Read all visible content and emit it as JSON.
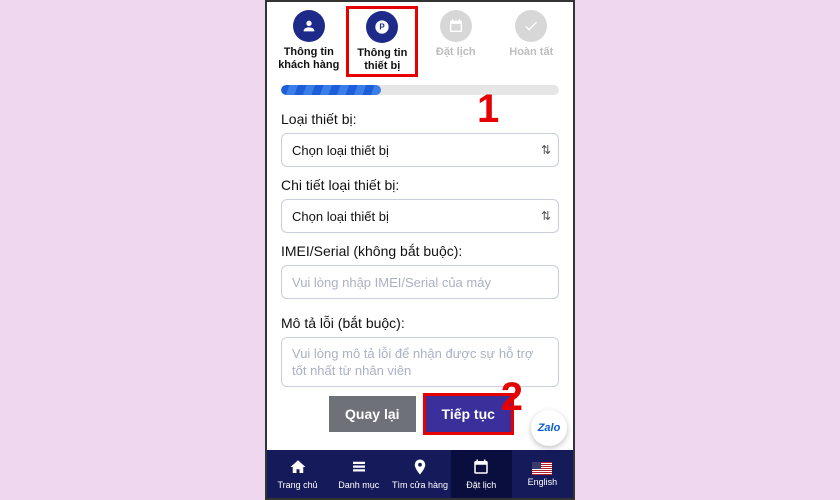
{
  "stepper": {
    "items": [
      {
        "label": "Thông tin khách hàng",
        "icon": "user-icon",
        "active": true
      },
      {
        "label": "Thông tin thiết bị",
        "icon": "p-icon",
        "active": true,
        "highlighted": true
      },
      {
        "label": "Đặt lịch",
        "icon": "calendar-icon",
        "active": false
      },
      {
        "label": "Hoàn tất",
        "icon": "check-icon",
        "active": false
      }
    ],
    "progress_percent": 36
  },
  "annotations": {
    "one": "1",
    "two": "2"
  },
  "form": {
    "device_type_label": "Loại thiết bị:",
    "device_type_value": "Chọn loại thiết bị",
    "device_detail_label": "Chi tiết loại thiết bị:",
    "device_detail_value": "Chọn loại thiết bị",
    "imei_label": "IMEI/Serial (không bắt buộc):",
    "imei_placeholder": "Vui lòng nhập IMEI/Serial của máy",
    "desc_label": "Mô tả lỗi (bắt buộc):",
    "desc_placeholder": "Vui lòng mô tả lỗi để nhận được sự hỗ trợ tốt nhất từ nhân viên"
  },
  "actions": {
    "back": "Quay lại",
    "next": "Tiếp tục"
  },
  "zalo_label": "Zalo",
  "nav": {
    "items": [
      {
        "label": "Trang chủ",
        "icon": "home-icon"
      },
      {
        "label": "Danh mục",
        "icon": "list-icon"
      },
      {
        "label": "Tìm cửa hàng",
        "icon": "pin-icon"
      },
      {
        "label": "Đặt lịch",
        "icon": "calendar-icon",
        "active": true
      },
      {
        "label": "English",
        "icon": "flag-icon"
      }
    ]
  }
}
